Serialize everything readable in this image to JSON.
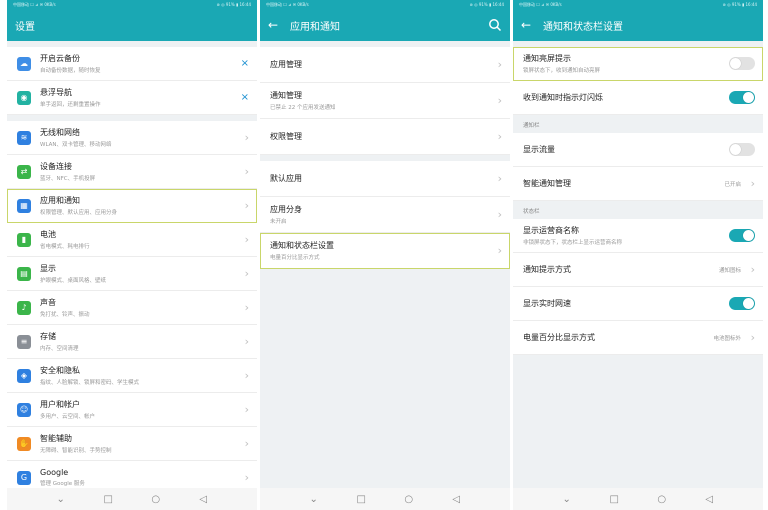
{
  "colors": {
    "accent": "#1aa8b4",
    "highlight": "#c9d66a",
    "link_x": "#1a8fd0"
  },
  "status": {
    "left": "中国移动 ☐ ⊿ ✉  0KB/s",
    "right": "⊛ ◎ 91% ▮ 16:44"
  },
  "nav": {
    "back": "⌄",
    "home": "□",
    "recent": "○",
    "menu": "◁"
  },
  "screen1": {
    "title": "设置",
    "items": [
      {
        "title": "开启云备份",
        "sub": "自动备份数据，随时恢复",
        "icon": "cloud-icon",
        "color": "#3f8ee6",
        "action": "×"
      },
      {
        "title": "悬浮导航",
        "sub": "单手返回，还剩重置操作",
        "icon": "float-nav-icon",
        "color": "#22b2a2",
        "action": "×"
      },
      {
        "title": "无线和网络",
        "sub": "WLAN、双卡管理、移动网络",
        "icon": "wifi-icon",
        "color": "#2f80e0",
        "action": "›"
      },
      {
        "title": "设备连接",
        "sub": "蓝牙、NFC、手机投屏",
        "icon": "device-link-icon",
        "color": "#3bb54a",
        "action": "›"
      },
      {
        "title": "应用和通知",
        "sub": "权限管理、默认应用、应用分身",
        "icon": "apps-icon",
        "color": "#2f80e0",
        "action": "›",
        "highlight": true
      },
      {
        "title": "电池",
        "sub": "省电模式、耗电排行",
        "icon": "battery-icon",
        "color": "#3bb54a",
        "action": "›"
      },
      {
        "title": "显示",
        "sub": "护眼模式、桌面风格、壁纸",
        "icon": "display-icon",
        "color": "#3bb54a",
        "action": "›"
      },
      {
        "title": "声音",
        "sub": "免打扰、铃声、振动",
        "icon": "sound-icon",
        "color": "#3bb54a",
        "action": "›"
      },
      {
        "title": "存储",
        "sub": "内存、空间清理",
        "icon": "storage-icon",
        "color": "#8a8f96",
        "action": "›"
      },
      {
        "title": "安全和隐私",
        "sub": "指纹、人脸解锁、锁屏和密码、学生模式",
        "icon": "security-icon",
        "color": "#2f80e0",
        "action": "›"
      },
      {
        "title": "用户和帐户",
        "sub": "多用户、云空间、帐户",
        "icon": "user-icon",
        "color": "#2f80e0",
        "action": "›"
      },
      {
        "title": "智能辅助",
        "sub": "无障碍、智能识别、手势控制",
        "icon": "assist-icon",
        "color": "#f08a24",
        "action": "›"
      },
      {
        "title": "Google",
        "sub": "管理 Google 服务",
        "icon": "google-icon",
        "color": "#2f80e0",
        "action": "›"
      }
    ]
  },
  "screen2": {
    "back": "←",
    "title": "应用和通知",
    "groups": [
      [
        {
          "title": "应用管理",
          "sub": ""
        },
        {
          "title": "通知管理",
          "sub": "已禁止 22 个应用发送通知"
        },
        {
          "title": "权限管理",
          "sub": ""
        }
      ],
      [
        {
          "title": "默认应用",
          "sub": ""
        },
        {
          "title": "应用分身",
          "sub": "未开启"
        },
        {
          "title": "通知和状态栏设置",
          "sub": "电量百分比显示方式",
          "highlight": true
        }
      ]
    ]
  },
  "screen3": {
    "back": "←",
    "title": "通知和状态栏设置",
    "row_lock": {
      "title": "通知亮屏提示",
      "sub": "锁屏状态下，收到通知自动亮屏",
      "toggle": "off"
    },
    "row_led": {
      "title": "收到通知时指示灯闪烁",
      "toggle": "on"
    },
    "section_notify": "通知栏",
    "row_traffic": {
      "title": "显示流量",
      "toggle": "off"
    },
    "row_smart": {
      "title": "智能通知管理",
      "value": "已开启"
    },
    "section_status": "状态栏",
    "row_carrier": {
      "title": "显示运营商名称",
      "sub": "非锁屏状态下，状态栏上显示运营商名称",
      "toggle": "on"
    },
    "row_style": {
      "title": "通知提示方式",
      "value": "通知图标"
    },
    "row_speed": {
      "title": "显示实时网速",
      "toggle": "on"
    },
    "row_battery": {
      "title": "电量百分比显示方式",
      "value": "电池图标外"
    }
  }
}
